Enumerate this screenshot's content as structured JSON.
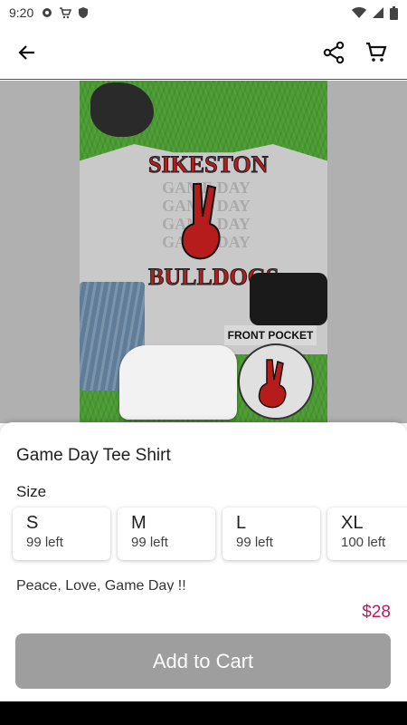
{
  "status_bar": {
    "time": "9:20",
    "icons": [
      "settings-icon",
      "shopping-cart-icon",
      "shield-icon"
    ],
    "right_icons": [
      "wifi-icon",
      "signal-icon",
      "battery-icon"
    ]
  },
  "app_bar": {
    "icons": {
      "back": "arrow-left-icon",
      "share": "share-icon",
      "cart": "cart-icon"
    }
  },
  "product_image": {
    "shirt_top_text": "SIKESTON",
    "shirt_bottom_text": "BULLDOGS",
    "shirt_repeat_text": [
      "GAME DAY",
      "GAME DAY",
      "GAME DAY",
      "GAME DAY"
    ],
    "pocket_label": "FRONT POCKET"
  },
  "product": {
    "title": "Game Day Tee Shirt",
    "size_label": "Size",
    "sizes": [
      {
        "name": "S",
        "stock": "99 left"
      },
      {
        "name": "M",
        "stock": "99 left"
      },
      {
        "name": "L",
        "stock": "99 left"
      },
      {
        "name": "XL",
        "stock": "100 left"
      }
    ],
    "description": "Peace, Love, Game Day !!",
    "price": "$28"
  },
  "actions": {
    "add_to_cart": "Add to Cart"
  },
  "colors": {
    "accent": "#c2185b",
    "button": "#9e9e9e"
  }
}
